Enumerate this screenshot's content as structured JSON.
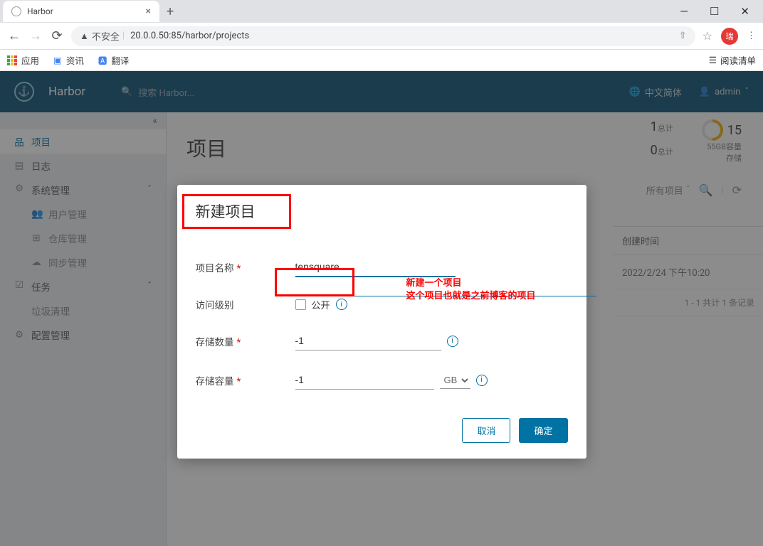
{
  "browser": {
    "tab_title": "Harbor",
    "url_warning": "不安全",
    "url": "20.0.0.50:85/harbor/projects",
    "profile_initial": "瑞",
    "bookmarks": {
      "apps": "应用",
      "news": "资讯",
      "translate": "翻译",
      "reading_list": "阅读清单"
    }
  },
  "header": {
    "brand": "Harbor",
    "search_placeholder": "搜索 Harbor...",
    "lang": "中文简体",
    "user": "admin"
  },
  "sidebar": {
    "projects": "项目",
    "logs": "日志",
    "system": "系统管理",
    "users": "用户管理",
    "repos": "仓库管理",
    "sync": "同步管理",
    "tasks": "任务",
    "gc": "垃圾清理",
    "config": "配置管理"
  },
  "main": {
    "title": "项目",
    "stats": {
      "private_count": "1",
      "private_label": "总计",
      "public_count": "0",
      "public_label": "总计",
      "quota": "15",
      "quota_label": "55GB容量",
      "storage_label": "存储"
    },
    "filter": "所有项目",
    "table": {
      "col_time": "创建时间",
      "row1_time": "2022/2/24 下午10:20",
      "footer": "1 - 1 共计 1 条记录"
    }
  },
  "modal": {
    "title": "新建项目",
    "field_name": "项目名称",
    "name_value": "tensquare",
    "field_access": "访问级别",
    "access_public": "公开",
    "field_count": "存储数量",
    "count_value": "-1",
    "field_capacity": "存储容量",
    "capacity_value": "-1",
    "unit": "GB",
    "btn_cancel": "取消",
    "btn_ok": "确定"
  },
  "annotation": {
    "line1": "新建一个项目",
    "line2": "这个项目也就是之前博客的项目"
  }
}
